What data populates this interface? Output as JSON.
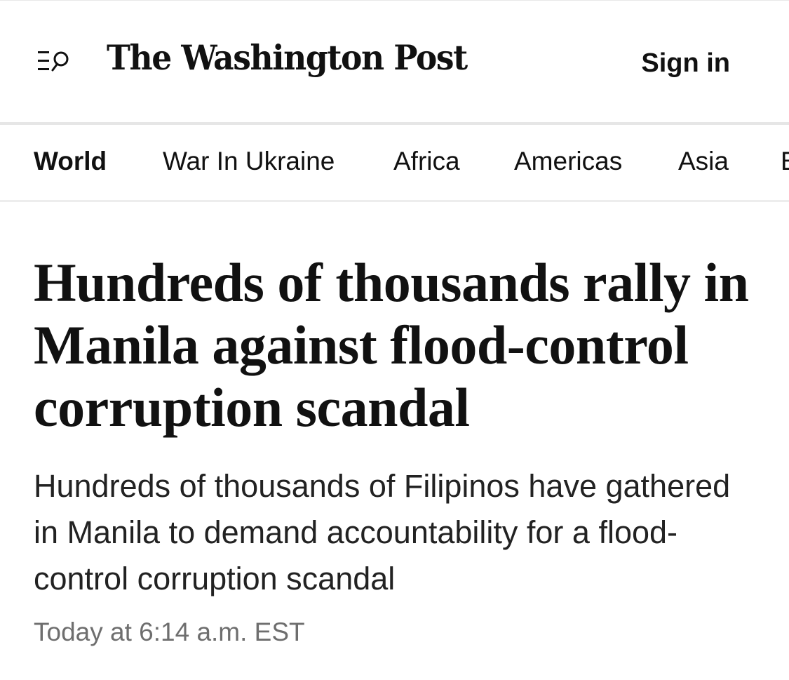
{
  "header": {
    "masthead": "The Washington Post",
    "sign_in_label": "Sign in",
    "menu_icon": "menu-search-icon"
  },
  "nav": {
    "items": [
      {
        "label": "World",
        "active": true
      },
      {
        "label": "War In Ukraine",
        "active": false
      },
      {
        "label": "Africa",
        "active": false
      },
      {
        "label": "Americas",
        "active": false
      },
      {
        "label": "Asia",
        "active": false
      },
      {
        "label": "E",
        "active": false
      }
    ]
  },
  "article": {
    "headline": "Hundreds of thousands rally in Manila against flood-control corruption scandal",
    "dek": "Hundreds of thousands of Filipinos have gathered in Manila to demand accountability for a flood-control corruption scandal",
    "timestamp": "Today at 6:14 a.m. EST"
  },
  "colors": {
    "text": "#111111",
    "timestamp": "#6e6e6e",
    "divider": "#e6e6e6"
  }
}
